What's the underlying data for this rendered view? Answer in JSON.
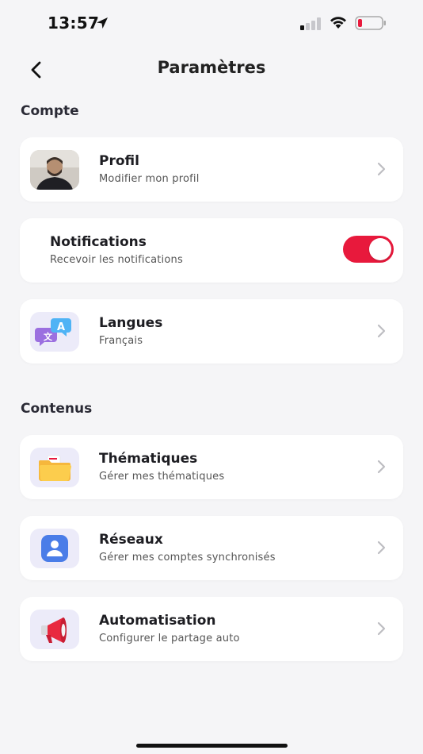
{
  "status_bar": {
    "time": "13:57"
  },
  "header": {
    "title": "Paramètres"
  },
  "sections": {
    "compte": "Compte",
    "contenus": "Contenus"
  },
  "items": {
    "profil": {
      "title": "Profil",
      "subtitle": "Modifier mon profil",
      "icon": "avatar"
    },
    "notifications": {
      "title": "Notifications",
      "subtitle": "Recevoir les notifications",
      "enabled": true
    },
    "langues": {
      "title": "Langues",
      "subtitle": "Français",
      "icon": "translate-icon"
    },
    "thematiques": {
      "title": "Thématiques",
      "subtitle": "Gérer mes thématiques",
      "icon": "folder-icon"
    },
    "reseaux": {
      "title": "Réseaux",
      "subtitle": "Gérer mes comptes synchronisés",
      "icon": "user-account-icon"
    },
    "automatisation": {
      "title": "Automatisation",
      "subtitle": "Configurer le partage auto",
      "icon": "megaphone-icon"
    }
  },
  "colors": {
    "accent": "#e8193c",
    "background": "#f5f5f7",
    "card": "#ffffff"
  }
}
